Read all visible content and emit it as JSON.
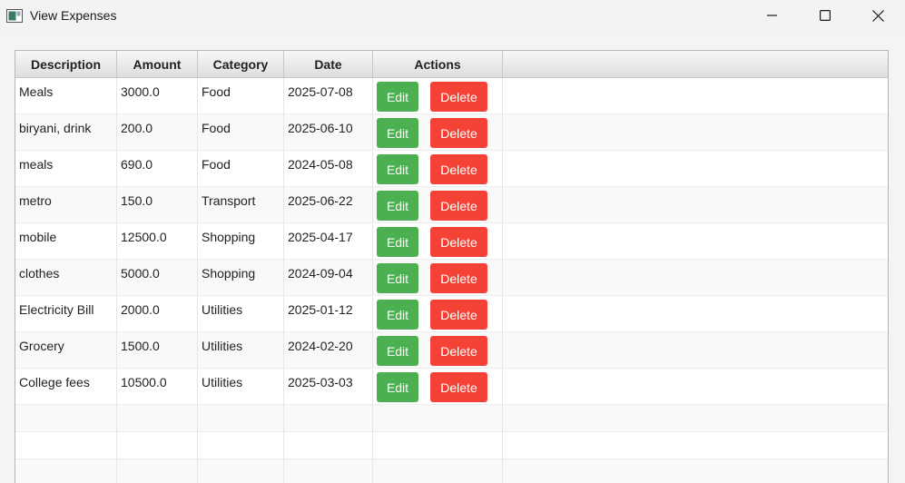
{
  "window": {
    "title": "View Expenses"
  },
  "table": {
    "columns": [
      "Description",
      "Amount",
      "Category",
      "Date",
      "Actions"
    ],
    "edit_label": "Edit",
    "delete_label": "Delete",
    "rows": [
      {
        "description": "Meals",
        "amount": "3000.0",
        "category": "Food",
        "date": "2025-07-08"
      },
      {
        "description": "biryani, drink",
        "amount": "200.0",
        "category": "Food",
        "date": "2025-06-10"
      },
      {
        "description": "meals",
        "amount": "690.0",
        "category": "Food",
        "date": "2024-05-08"
      },
      {
        "description": "metro",
        "amount": "150.0",
        "category": "Transport",
        "date": "2025-06-22"
      },
      {
        "description": "mobile",
        "amount": "12500.0",
        "category": "Shopping",
        "date": "2025-04-17"
      },
      {
        "description": "clothes",
        "amount": "5000.0",
        "category": "Shopping",
        "date": "2024-09-04"
      },
      {
        "description": "Electricity Bill",
        "amount": "2000.0",
        "category": "Utilities",
        "date": "2025-01-12"
      },
      {
        "description": "Grocery",
        "amount": "1500.0",
        "category": "Utilities",
        "date": "2024-02-20"
      },
      {
        "description": "College fees",
        "amount": "10500.0",
        "category": "Utilities",
        "date": "2025-03-03"
      }
    ]
  },
  "colors": {
    "edit_button": "#4caf50",
    "delete_button": "#f44336"
  },
  "icons": {
    "app": "window-app-icon",
    "minimize": "minimize-icon",
    "maximize": "maximize-icon",
    "close": "close-icon"
  }
}
